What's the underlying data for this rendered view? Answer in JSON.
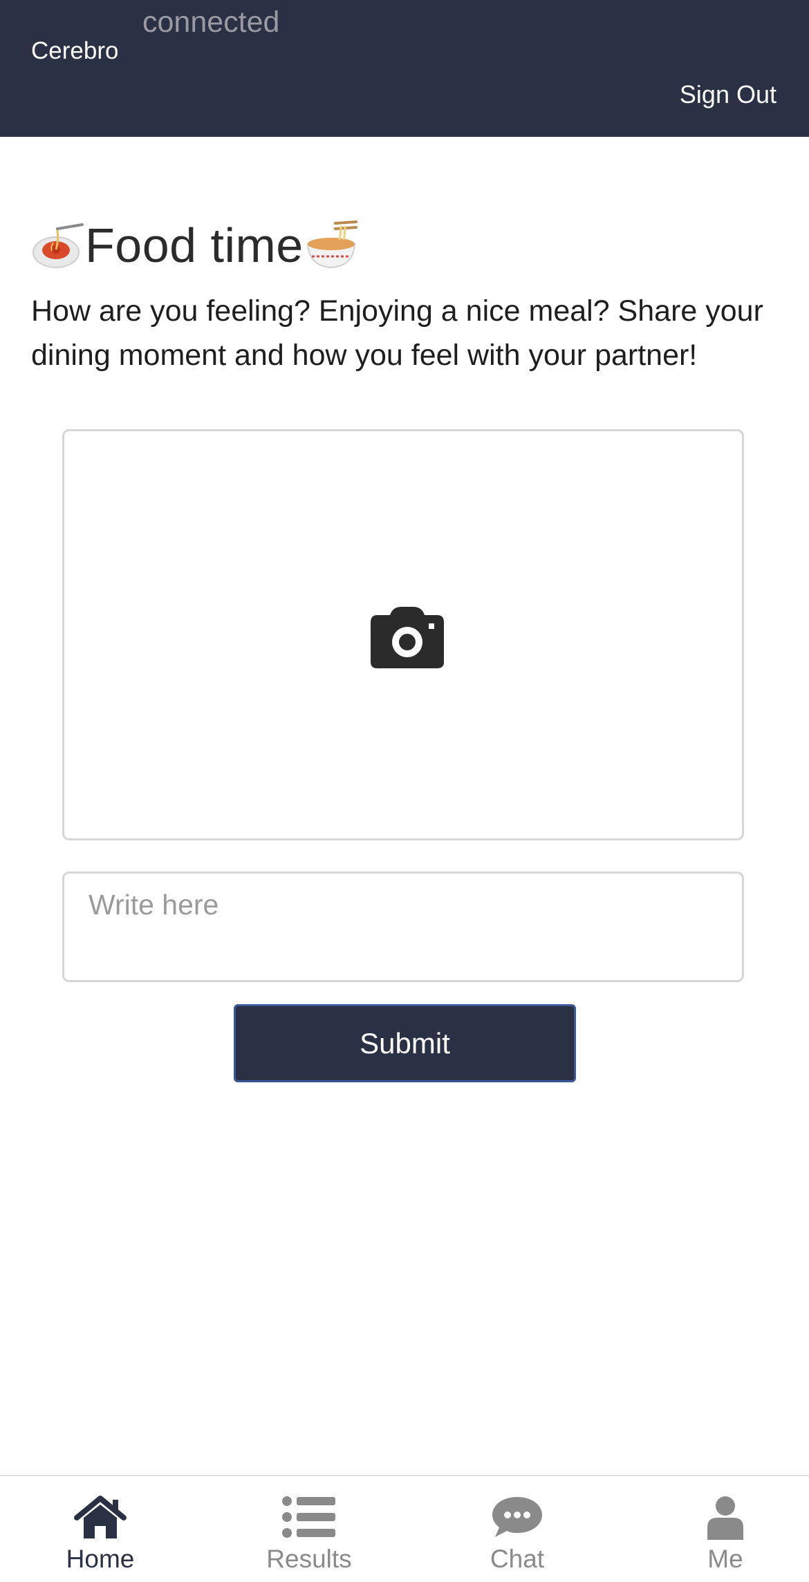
{
  "header": {
    "brand": "Cerebro",
    "status": "connected",
    "sign_out_label": "Sign Out"
  },
  "main": {
    "title": "Food time",
    "title_left_emoji": "spaghetti-icon",
    "title_right_emoji": "noodle-bowl-icon",
    "description": "How are you feeling? Enjoying a nice meal? Share your dining moment and how you feel with your partner!",
    "photo_upload_icon": "camera-icon",
    "input_placeholder": "Write here",
    "input_value": "",
    "submit_label": "Submit"
  },
  "bottom_nav": {
    "items": [
      {
        "label": "Home",
        "icon": "home-icon",
        "active": true
      },
      {
        "label": "Results",
        "icon": "list-icon",
        "active": false
      },
      {
        "label": "Chat",
        "icon": "chat-bubble-icon",
        "active": false
      },
      {
        "label": "Me",
        "icon": "user-icon",
        "active": false
      }
    ]
  },
  "colors": {
    "header_bg": "#2a3145",
    "active_nav": "#2a3145",
    "inactive_nav": "#8a8a8a",
    "button_border": "#3b5998"
  }
}
